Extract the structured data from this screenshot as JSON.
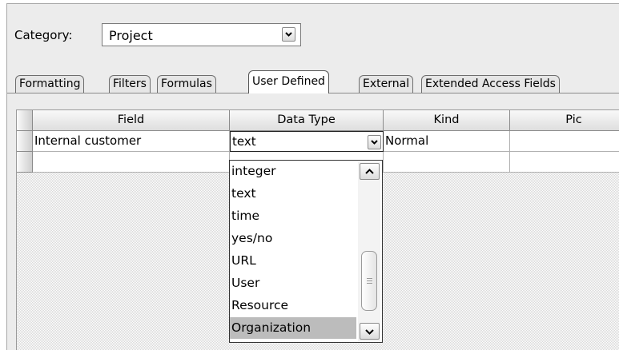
{
  "category": {
    "label": "Category:",
    "value": "Project"
  },
  "tabs": [
    {
      "label": "Formatting",
      "active": false
    },
    {
      "label": "Filters",
      "active": false
    },
    {
      "label": "Formulas",
      "active": false
    },
    {
      "label": "User Defined",
      "active": true
    },
    {
      "label": "External",
      "active": false
    },
    {
      "label": "Extended Access Fields",
      "active": false
    }
  ],
  "grid": {
    "columns": [
      "Field",
      "Data Type",
      "Kind",
      "Pic"
    ],
    "rows": [
      {
        "field": "Internal customer",
        "data_type": "text",
        "kind": "Normal",
        "pick": ""
      },
      {
        "field": "",
        "data_type": "",
        "kind": "",
        "pick": ""
      }
    ]
  },
  "dropdown": {
    "items": [
      "integer",
      "text",
      "time",
      "yes/no",
      "URL",
      "User",
      "Resource",
      "Organization"
    ],
    "selected": "Organization"
  },
  "icons": {
    "dropdown_arrow": "chevron-down-icon",
    "scroll_up": "chevron-up-icon",
    "scroll_down": "chevron-down-icon",
    "thumb_grip": "grip-icon"
  },
  "colors": {
    "selected_item": "#bcbcbc",
    "frame_bg": "#ececec"
  }
}
